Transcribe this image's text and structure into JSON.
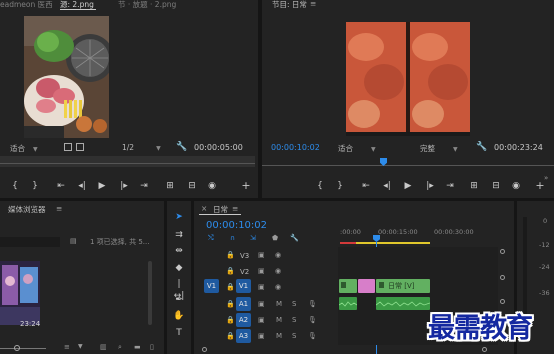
{
  "source_monitor": {
    "tab_partial_left": "eadmeon 医西",
    "tab_active": "源: 2.png",
    "tab_partial_right": "节 · 放题 · 2.png",
    "fit_label": "适合",
    "resolution_label": "1/2",
    "timecode_right": "00:00:05:00"
  },
  "program_monitor": {
    "tab_title": "节目: 日常",
    "timecode_left": "00:00:10:02",
    "fit_label": "适合",
    "quality_label": "完整",
    "timecode_right": "00:00:23:24"
  },
  "media_browser": {
    "tab_title": "媒体浏览器",
    "status_text": "1 项已选择, 共 5...",
    "thumb_duration": "23:24"
  },
  "timeline": {
    "close_glyph": "×",
    "tab_title": "日常",
    "timecode": "00:00:10:02",
    "ruler_labels": [
      ":00:00",
      "00:00:15:00",
      "00:00:30:00"
    ],
    "video_tracks": [
      {
        "name": "V3"
      },
      {
        "name": "V2"
      },
      {
        "name": "V1",
        "source_patch": "V1"
      }
    ],
    "audio_tracks": [
      {
        "name": "A1",
        "source_patch": "A1",
        "m": "M",
        "s": "S"
      },
      {
        "name": "A2",
        "m": "M",
        "s": "S"
      },
      {
        "name": "A3",
        "m": "M",
        "s": "S"
      }
    ],
    "clip_label": "日常 [V]"
  },
  "audio_meter": {
    "ticks": [
      "0",
      "-12",
      "-24",
      "-36"
    ]
  },
  "watermark": "最需教育",
  "colors": {
    "accent_blue": "#2d8ceb",
    "clip_green": "#62b061",
    "clip_pink": "#d77ec9",
    "audio_green": "#3b9a45",
    "track_blue": "#1f5aa0",
    "ruler_yellow": "#e0c72c",
    "watermark_blue": "#1428a0"
  }
}
